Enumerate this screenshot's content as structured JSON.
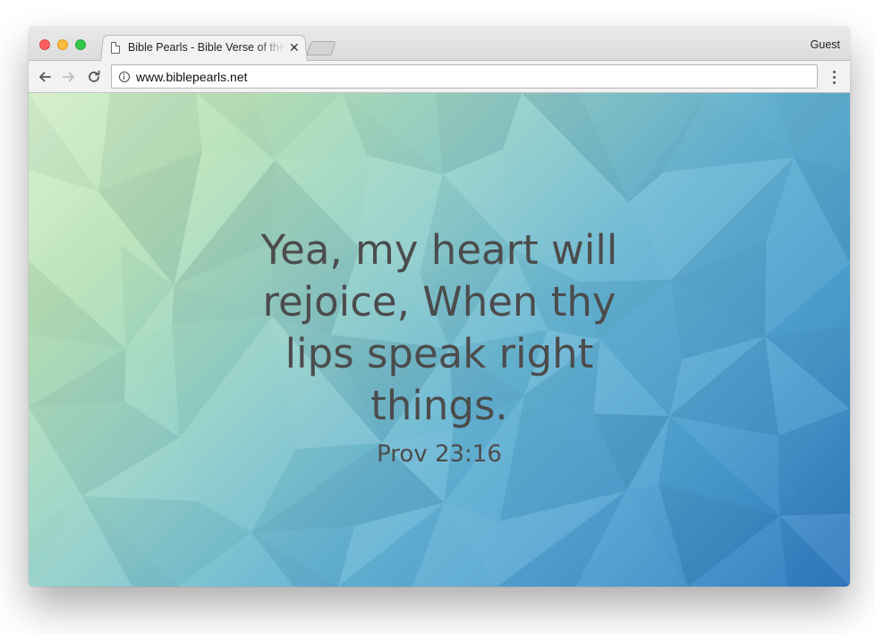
{
  "browser": {
    "tab_title": "Bible Pearls - Bible Verse of the Day",
    "profile_label": "Guest",
    "url": "www.biblepearls.net"
  },
  "page": {
    "verse_text": "Yea, my heart will rejoice, When thy lips speak right things.",
    "verse_reference": "Prov 23:16"
  },
  "colors": {
    "text": "#4c4c4c",
    "gradient_start": "#d6efcc",
    "gradient_end": "#2f78bf"
  }
}
